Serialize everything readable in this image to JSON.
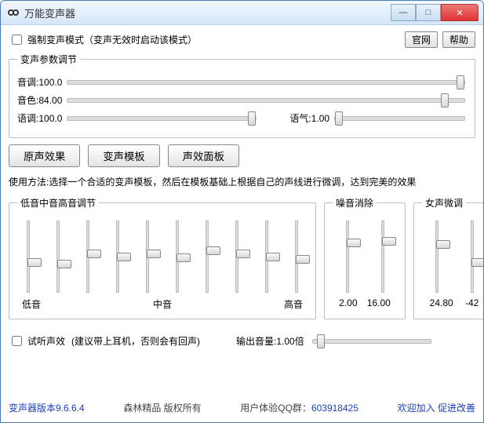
{
  "window": {
    "title": "万能变声器"
  },
  "top": {
    "force_mode_label": "强制变声模式（变声无效时启动该模式）",
    "official_btn": "官网",
    "help_btn": "帮助"
  },
  "params": {
    "legend": "变声参数调节",
    "pitch_label": "音调:",
    "pitch_value": "100.0",
    "timbre_label": "音色:",
    "timbre_value": "84.00",
    "tone_label": "语调:",
    "tone_value": "100.0",
    "mood_label": "语气:",
    "mood_value": "1.00"
  },
  "tabs": {
    "orig": "原声效果",
    "template": "变声模板",
    "fx_panel": "声效面板"
  },
  "usage_text": "使用方法:选择一个合适的变声模板，然后在模板基础上根据自己的声线进行微调，达到完美的效果",
  "eq": {
    "legend": "低音中音高音调节",
    "low": "低音",
    "mid": "中音",
    "high": "高音"
  },
  "noise": {
    "legend": "噪音消除",
    "v1": "2.00",
    "v2": "16.00"
  },
  "female": {
    "legend": "女声微调",
    "v1": "24.80",
    "v2": "-42"
  },
  "bottom": {
    "listen_label": "试听声效",
    "listen_hint": "(建议带上耳机，否则会有回声)",
    "out_vol_label": "输出音量:",
    "out_vol_value": "1.00倍"
  },
  "footer": {
    "version": "变声器版本9.6.6.4",
    "copyright": "森林精品 版权所有",
    "qq_label": "用户体验QQ群：",
    "qq_num": "603918425",
    "join": "欢迎加入 促进改善"
  }
}
